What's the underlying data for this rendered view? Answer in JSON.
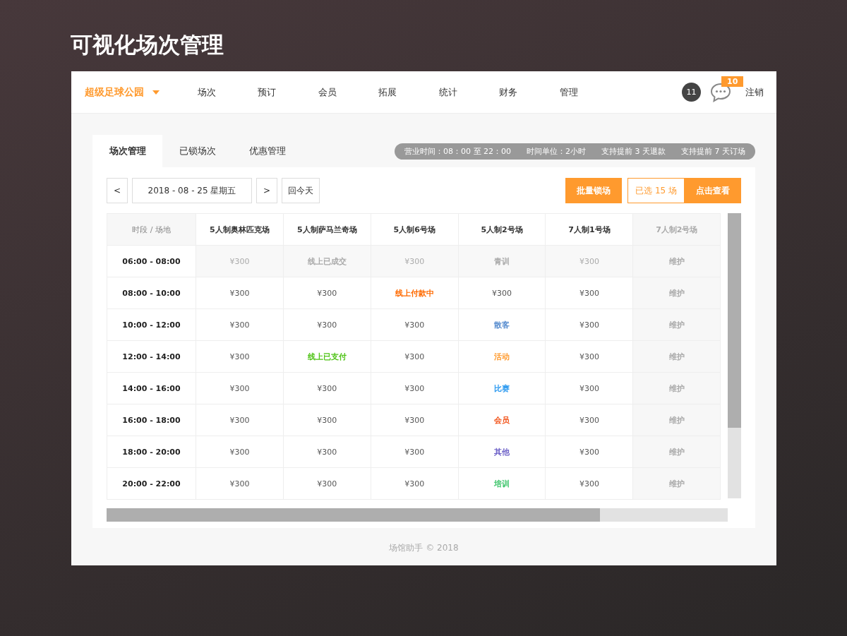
{
  "page_title": "可视化场次管理",
  "header": {
    "venue": "超级足球公园",
    "nav": [
      "场次",
      "预订",
      "会员",
      "拓展",
      "统计",
      "财务",
      "管理"
    ],
    "user_count": "11",
    "message_badge": "10",
    "logout": "注销"
  },
  "tabs": [
    {
      "label": "场次管理",
      "selected": true
    },
    {
      "label": "已锁场次",
      "selected": false
    },
    {
      "label": "优惠管理",
      "selected": false
    }
  ],
  "info": [
    "营业时间：08：00 至 22：00",
    "时间单位：2小时",
    "支持提前 3 天退款",
    "支持提前 7 天订场"
  ],
  "toolbar": {
    "prev": "<",
    "date": "2018 - 08 - 25 星期五",
    "next": ">",
    "today": "回今天",
    "lock": "批量锁场",
    "selected_count": "已选 15 场",
    "view": "点击查看"
  },
  "table": {
    "corner": "时段 / 场地",
    "columns": [
      {
        "label": "5人制奥林匹克场",
        "disabled": false
      },
      {
        "label": "5人制萨马兰奇场",
        "disabled": false
      },
      {
        "label": "5人制6号场",
        "disabled": false
      },
      {
        "label": "5人制2号场",
        "disabled": false
      },
      {
        "label": "7人制1号场",
        "disabled": false
      },
      {
        "label": "7人制2号场",
        "disabled": true
      }
    ],
    "rows": [
      {
        "time": "06:00 - 08:00",
        "past": true,
        "cells": [
          {
            "kind": "price",
            "text": "¥300"
          },
          {
            "kind": "status",
            "text": "线上已成交",
            "color": "#aaaaaa"
          },
          {
            "kind": "price",
            "text": "¥300"
          },
          {
            "kind": "status",
            "text": "青训",
            "color": "#aaaaaa"
          },
          {
            "kind": "price",
            "text": "¥300"
          },
          {
            "kind": "status",
            "text": "维护",
            "color": "#aaaaaa"
          }
        ]
      },
      {
        "time": "08:00 - 10:00",
        "past": false,
        "cells": [
          {
            "kind": "price",
            "text": "¥300"
          },
          {
            "kind": "price",
            "text": "¥300"
          },
          {
            "kind": "status",
            "text": "线上付款中",
            "color": "#ff6a00"
          },
          {
            "kind": "price",
            "text": "¥300"
          },
          {
            "kind": "price",
            "text": "¥300"
          },
          {
            "kind": "status",
            "text": "维护",
            "color": "#aaaaaa"
          }
        ]
      },
      {
        "time": "10:00 - 12:00",
        "past": false,
        "cells": [
          {
            "kind": "price",
            "text": "¥300"
          },
          {
            "kind": "price",
            "text": "¥300"
          },
          {
            "kind": "price",
            "text": "¥300"
          },
          {
            "kind": "status",
            "text": "散客",
            "color": "#5b8fd0"
          },
          {
            "kind": "price",
            "text": "¥300"
          },
          {
            "kind": "status",
            "text": "维护",
            "color": "#aaaaaa"
          }
        ]
      },
      {
        "time": "12:00 - 14:00",
        "past": false,
        "cells": [
          {
            "kind": "price",
            "text": "¥300"
          },
          {
            "kind": "status",
            "text": "线上已支付",
            "color": "#52c41a"
          },
          {
            "kind": "price",
            "text": "¥300"
          },
          {
            "kind": "status",
            "text": "活动",
            "color": "#ff9a2e"
          },
          {
            "kind": "price",
            "text": "¥300"
          },
          {
            "kind": "status",
            "text": "维护",
            "color": "#aaaaaa"
          }
        ]
      },
      {
        "time": "14:00 - 16:00",
        "past": false,
        "cells": [
          {
            "kind": "price",
            "text": "¥300"
          },
          {
            "kind": "price",
            "text": "¥300"
          },
          {
            "kind": "price",
            "text": "¥300"
          },
          {
            "kind": "status",
            "text": "比赛",
            "color": "#2f9bf0"
          },
          {
            "kind": "price",
            "text": "¥300"
          },
          {
            "kind": "status",
            "text": "维护",
            "color": "#aaaaaa"
          }
        ]
      },
      {
        "time": "16:00 - 18:00",
        "past": false,
        "cells": [
          {
            "kind": "price",
            "text": "¥300"
          },
          {
            "kind": "price",
            "text": "¥300"
          },
          {
            "kind": "price",
            "text": "¥300"
          },
          {
            "kind": "status",
            "text": "会员",
            "color": "#f2541b"
          },
          {
            "kind": "price",
            "text": "¥300"
          },
          {
            "kind": "status",
            "text": "维护",
            "color": "#aaaaaa"
          }
        ]
      },
      {
        "time": "18:00 - 20:00",
        "past": false,
        "cells": [
          {
            "kind": "price",
            "text": "¥300"
          },
          {
            "kind": "price",
            "text": "¥300"
          },
          {
            "kind": "price",
            "text": "¥300"
          },
          {
            "kind": "status",
            "text": "其他",
            "color": "#6b5fc7"
          },
          {
            "kind": "price",
            "text": "¥300"
          },
          {
            "kind": "status",
            "text": "维护",
            "color": "#aaaaaa"
          }
        ]
      },
      {
        "time": "20:00 - 22:00",
        "past": false,
        "cells": [
          {
            "kind": "price",
            "text": "¥300"
          },
          {
            "kind": "price",
            "text": "¥300"
          },
          {
            "kind": "price",
            "text": "¥300"
          },
          {
            "kind": "status",
            "text": "培训",
            "color": "#3cc46a"
          },
          {
            "kind": "price",
            "text": "¥300"
          },
          {
            "kind": "status",
            "text": "维护",
            "color": "#aaaaaa"
          }
        ]
      }
    ]
  },
  "footer": "场馆助手 © 2018"
}
